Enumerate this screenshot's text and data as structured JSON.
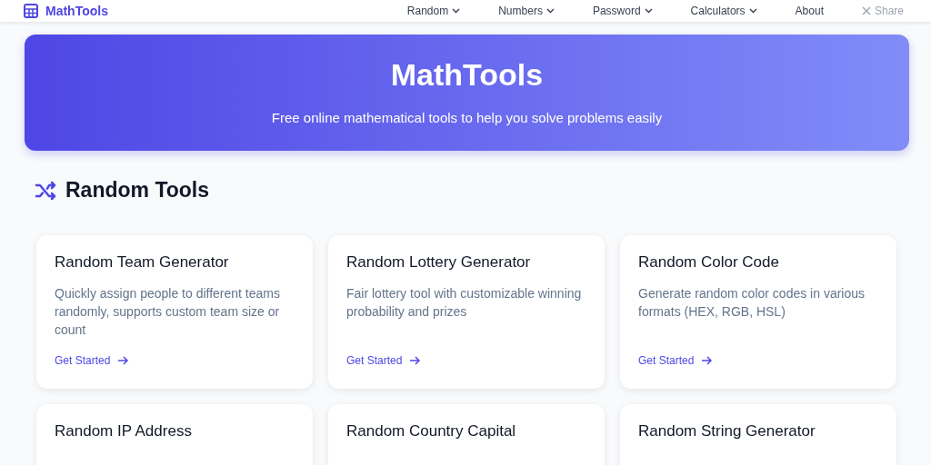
{
  "navbar": {
    "brand": "MathTools",
    "items": [
      {
        "label": "Random",
        "dropdown": true
      },
      {
        "label": "Numbers",
        "dropdown": true
      },
      {
        "label": "Password",
        "dropdown": true
      },
      {
        "label": "Calculators",
        "dropdown": true
      },
      {
        "label": "About",
        "dropdown": false
      }
    ],
    "share": "Share"
  },
  "hero": {
    "title": "MathTools",
    "subtitle": "Free online mathematical tools to help you solve problems easily"
  },
  "section": {
    "title": "Random Tools"
  },
  "cards": [
    {
      "title": "Random Team Generator",
      "description": "Quickly assign people to different teams randomly, supports custom team size or count",
      "link": "Get Started"
    },
    {
      "title": "Random Lottery Generator",
      "description": "Fair lottery tool with customizable winning probability and prizes",
      "link": "Get Started"
    },
    {
      "title": "Random Color Code",
      "description": "Generate random color codes in various formats (HEX, RGB, HSL)",
      "link": "Get Started"
    },
    {
      "title": "Random IP Address"
    },
    {
      "title": "Random Country Capital"
    },
    {
      "title": "Random String Generator"
    }
  ]
}
